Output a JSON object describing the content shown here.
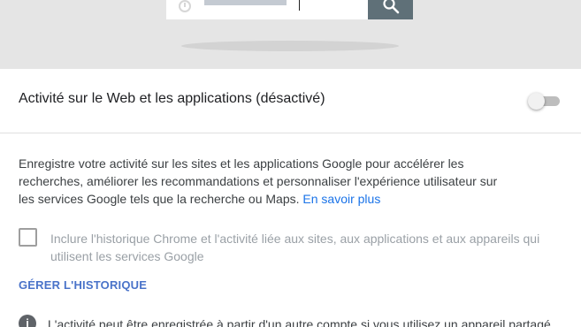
{
  "search": {
    "icon": "clock-icon",
    "button_icon": "search-icon"
  },
  "activity": {
    "title": "Activité sur le Web et les applications (désactivé)",
    "enabled": false
  },
  "description": {
    "text": "Enregistre votre activité sur les sites et les applications Google pour accélérer les recherches, améliorer les recommandations et personnaliser l'expérience utilisateur sur les services Google tels que la recherche ou Maps.",
    "link": "En savoir plus"
  },
  "chrome_history": {
    "label": "Inclure l'historique Chrome et l'activité liée aux sites, aux applications et aux appareils qui utilisent les services Google",
    "checked": false
  },
  "manage": {
    "label": "GÉRER L'HISTORIQUE"
  },
  "info": {
    "icon": "info-icon",
    "text": "L'activité peut être enregistrée à partir d'un autre compte si vous utilisez un appareil partagé"
  },
  "colors": {
    "link": "#1a73e8",
    "manage": "#4a73c9",
    "search_button": "#5f7078",
    "hero_background": "#e5e5e5"
  }
}
